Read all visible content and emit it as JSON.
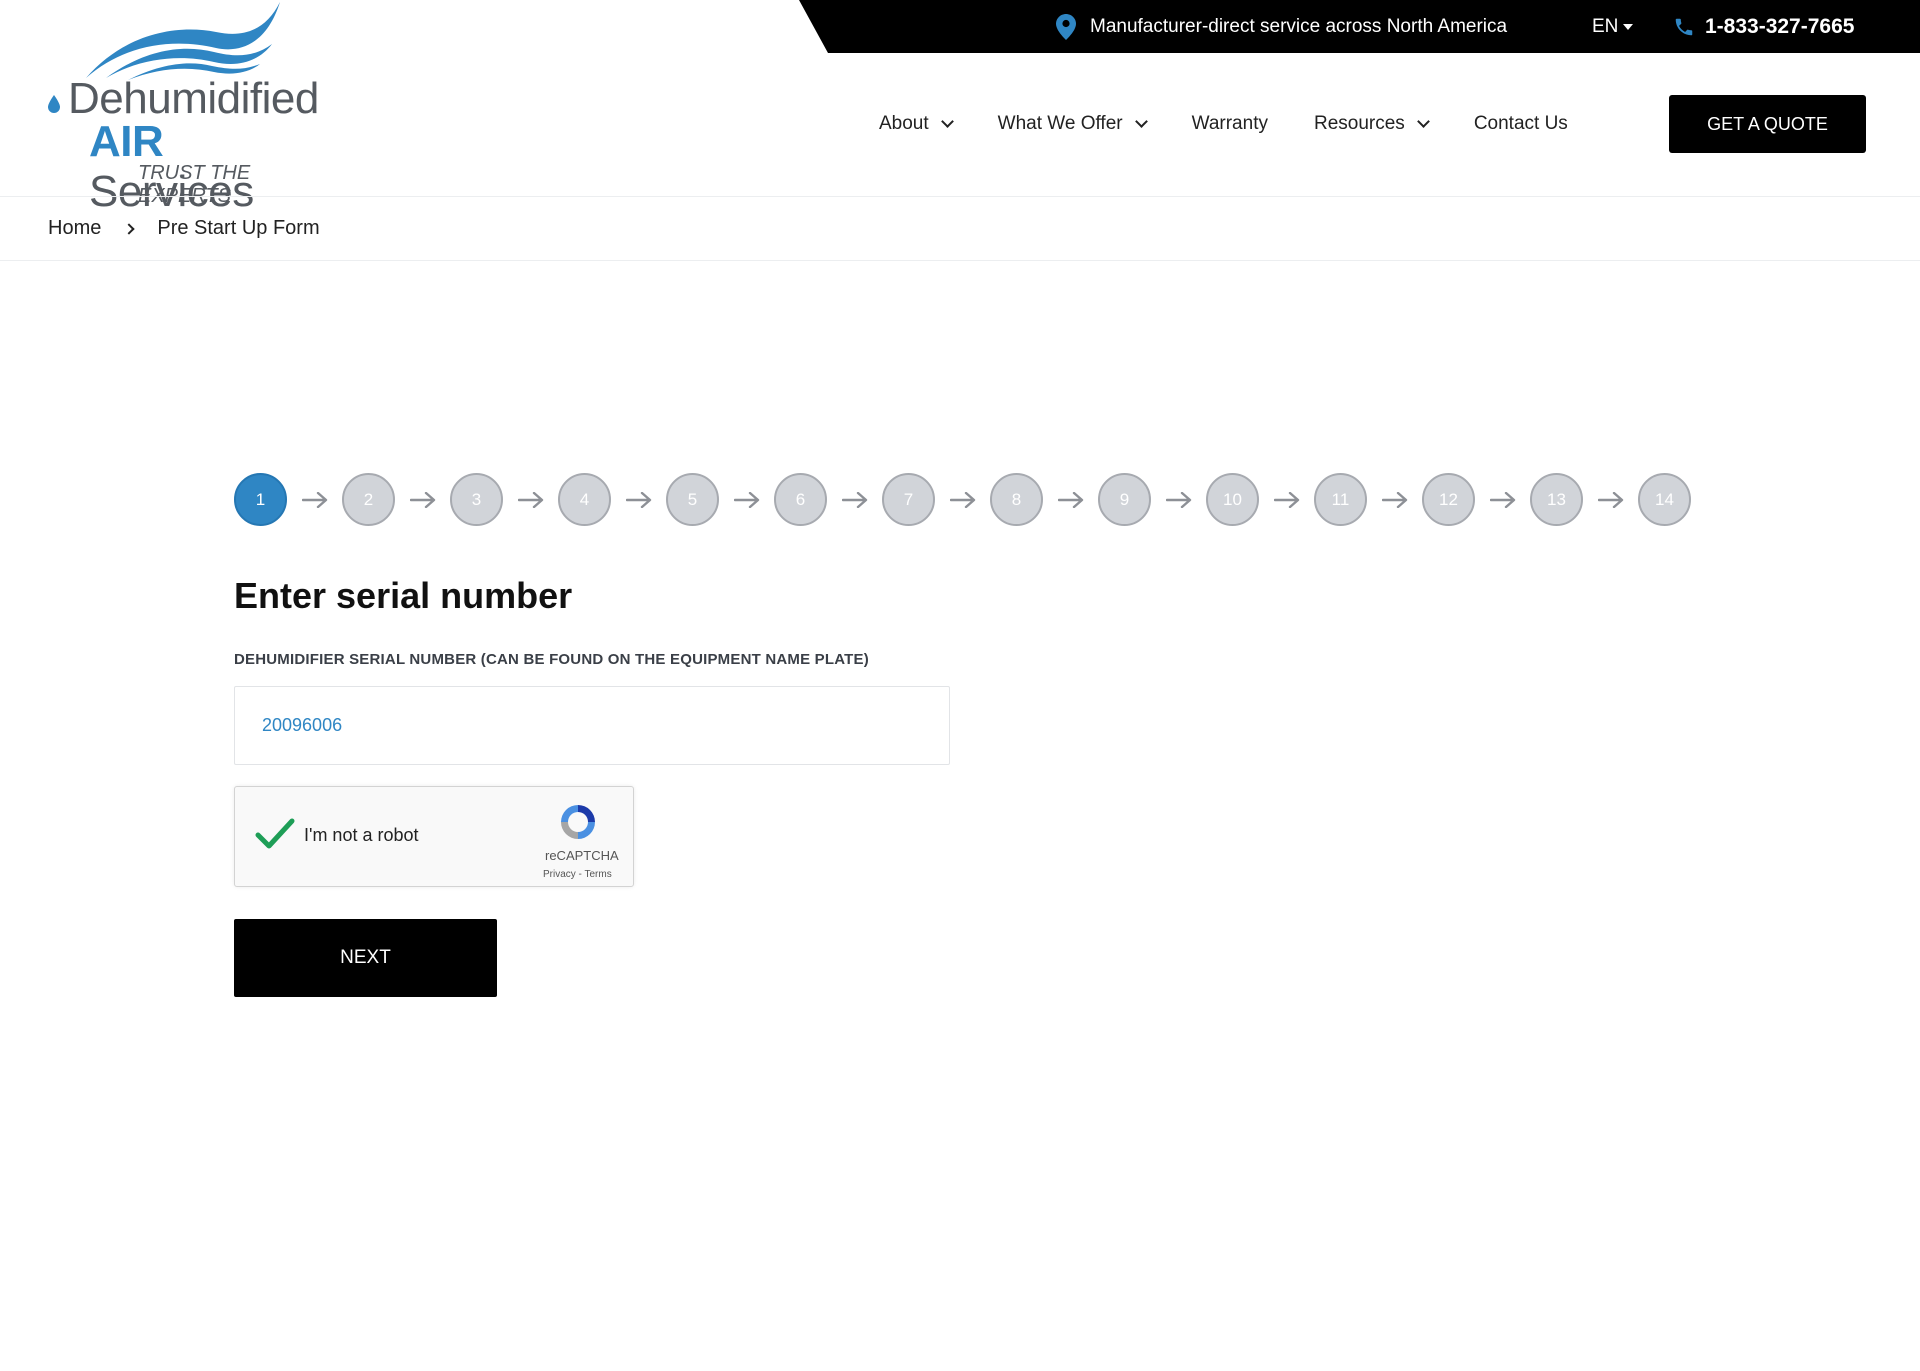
{
  "topbar": {
    "location_text": "Manufacturer-direct service across North America",
    "language": "EN",
    "phone": "1-833-327-7665"
  },
  "logo": {
    "line1": "Dehumidified",
    "line2_strong": "AIR",
    "line2_rest": " Services",
    "tagline": "TRUST THE EXPERTS"
  },
  "nav": {
    "items": [
      {
        "label": "About",
        "dropdown": true
      },
      {
        "label": "What We Offer",
        "dropdown": true
      },
      {
        "label": "Warranty",
        "dropdown": false
      },
      {
        "label": "Resources",
        "dropdown": true
      },
      {
        "label": "Contact Us",
        "dropdown": false
      }
    ],
    "cta": "GET A QUOTE"
  },
  "breadcrumb": {
    "home": "Home",
    "current": "Pre Start Up Form"
  },
  "steps": {
    "labels": [
      "1",
      "2",
      "3",
      "4",
      "5",
      "6",
      "7",
      "8",
      "9",
      "10",
      "11",
      "12",
      "13",
      "14"
    ],
    "active": 1
  },
  "form": {
    "title": "Enter serial number",
    "field_label": "DEHUMIDIFIER SERIAL NUMBER (CAN BE FOUND ON THE EQUIPMENT NAME PLATE)",
    "serial_value": "20096006",
    "captcha_text": "I'm not a robot",
    "captcha_brand": "reCAPTCHA",
    "captcha_links": "Privacy - Terms",
    "next_label": "NEXT"
  },
  "colors": {
    "accent": "#2f86c4",
    "step_inactive": "#d1d4d9",
    "button_bg": "#000000",
    "captcha_check": "#1e9e57"
  },
  "icons": {
    "location": "map-pin-icon",
    "phone": "phone-icon",
    "captcha_check": "checkmark-icon",
    "captcha_logo": "recaptcha-logo-icon"
  }
}
